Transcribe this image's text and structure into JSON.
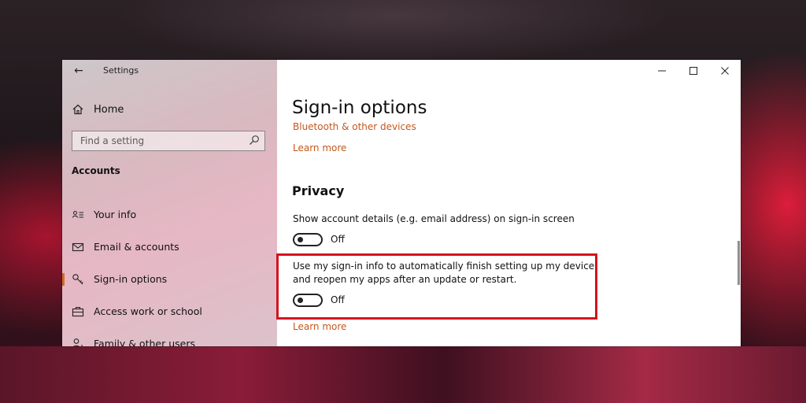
{
  "window": {
    "title": "Settings"
  },
  "sidebar": {
    "home_label": "Home",
    "search_placeholder": "Find a setting",
    "section_heading": "Accounts",
    "items": [
      {
        "label": "Your info",
        "icon": "person-card-icon"
      },
      {
        "label": "Email & accounts",
        "icon": "mail-icon"
      },
      {
        "label": "Sign-in options",
        "icon": "key-icon",
        "selected": true
      },
      {
        "label": "Access work or school",
        "icon": "briefcase-icon"
      },
      {
        "label": "Family & other users",
        "icon": "person-add-icon"
      }
    ]
  },
  "content": {
    "page_title": "Sign-in options",
    "partial_link": "Bluetooth & other devices",
    "learn_more_1": "Learn more",
    "privacy_heading": "Privacy",
    "setting_1": {
      "description": "Show account details (e.g. email address) on sign-in screen",
      "state": "Off"
    },
    "setting_2": {
      "description_line1": "Use my sign-in info to automatically finish setting up my device",
      "description_line2": "and reopen my apps after an update or restart.",
      "state": "Off"
    },
    "learn_more_2": "Learn more"
  },
  "colors": {
    "accent": "#d46a2a",
    "link": "#c4581c",
    "highlight": "#d4131f"
  }
}
